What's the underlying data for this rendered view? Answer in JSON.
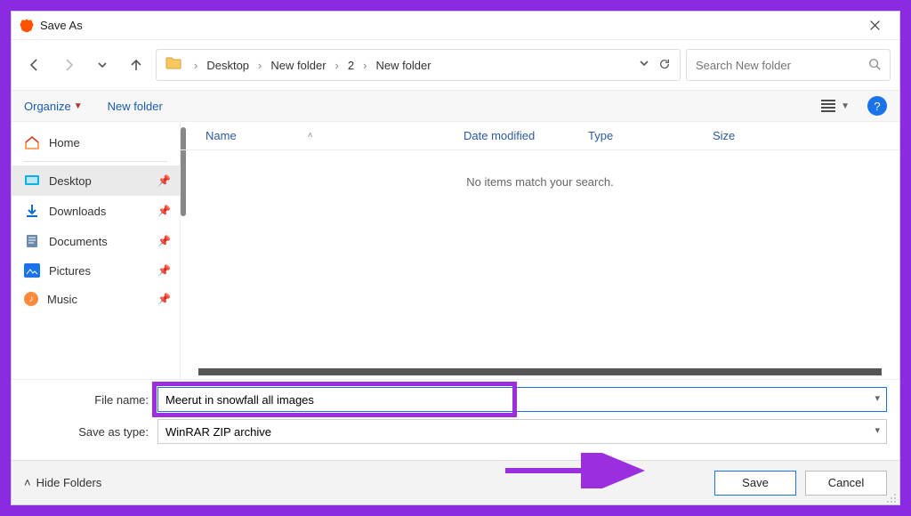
{
  "titlebar": {
    "title": "Save As"
  },
  "breadcrumbs": [
    "Desktop",
    "New folder",
    "2",
    "New folder"
  ],
  "search": {
    "placeholder": "Search New folder"
  },
  "toolbar": {
    "organize": "Organize",
    "newfolder": "New folder"
  },
  "sidebar": {
    "home": "Home",
    "items": [
      {
        "label": "Desktop"
      },
      {
        "label": "Downloads"
      },
      {
        "label": "Documents"
      },
      {
        "label": "Pictures"
      },
      {
        "label": "Music"
      }
    ]
  },
  "columns": {
    "name": "Name",
    "date": "Date modified",
    "type": "Type",
    "size": "Size"
  },
  "list": {
    "empty": "No items match your search."
  },
  "fields": {
    "filename_label": "File name:",
    "filename_value": "Meerut in snowfall all images",
    "savetype_label": "Save as type:",
    "savetype_value": "WinRAR ZIP archive"
  },
  "footer": {
    "hide": "Hide Folders",
    "save": "Save",
    "cancel": "Cancel"
  }
}
